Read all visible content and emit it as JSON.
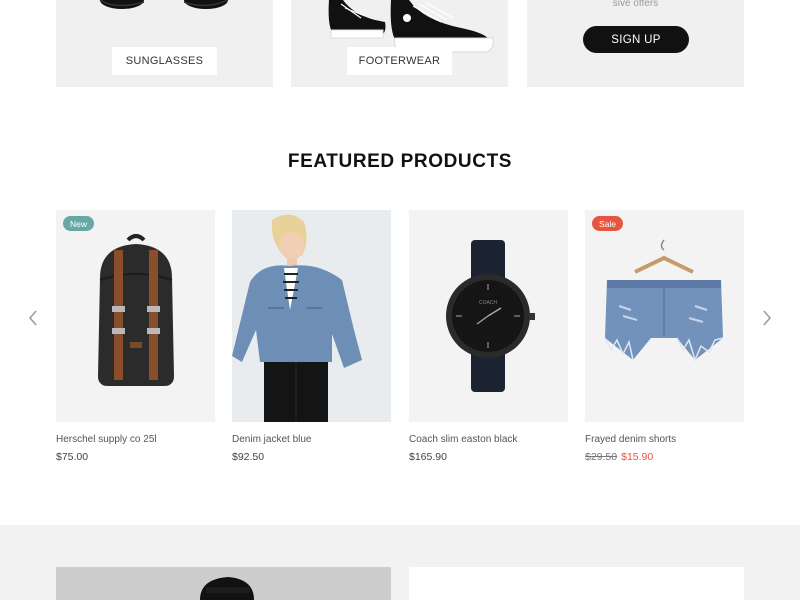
{
  "banners": {
    "sunglasses_label": "SUNGLASSES",
    "footwear_label": "FOOTERWEAR",
    "offer_text": "sive offers",
    "signup_label": "SIGN UP"
  },
  "featured": {
    "title": "FEATURED PRODUCTS",
    "products": [
      {
        "name": "Herschel supply co 25l",
        "price": "$75.00",
        "badge": "New",
        "image": "backpack-image"
      },
      {
        "name": "Denim jacket blue",
        "price": "$92.50",
        "badge": "",
        "image": "denim-jacket-image"
      },
      {
        "name": "Coach slim easton black",
        "price": "$165.90",
        "badge": "",
        "image": "watch-image"
      },
      {
        "name": "Frayed denim shorts",
        "old_price": "$29.50",
        "price": "$15.90",
        "badge": "Sale",
        "image": "denim-shorts-image"
      }
    ],
    "prev_icon": "chevron-left-icon",
    "next_icon": "chevron-right-icon"
  },
  "colors": {
    "new_badge": "#66a8a6",
    "sale_badge": "#e65540",
    "signup_bg": "#111111",
    "banner_bg": "#f0f0f0"
  }
}
